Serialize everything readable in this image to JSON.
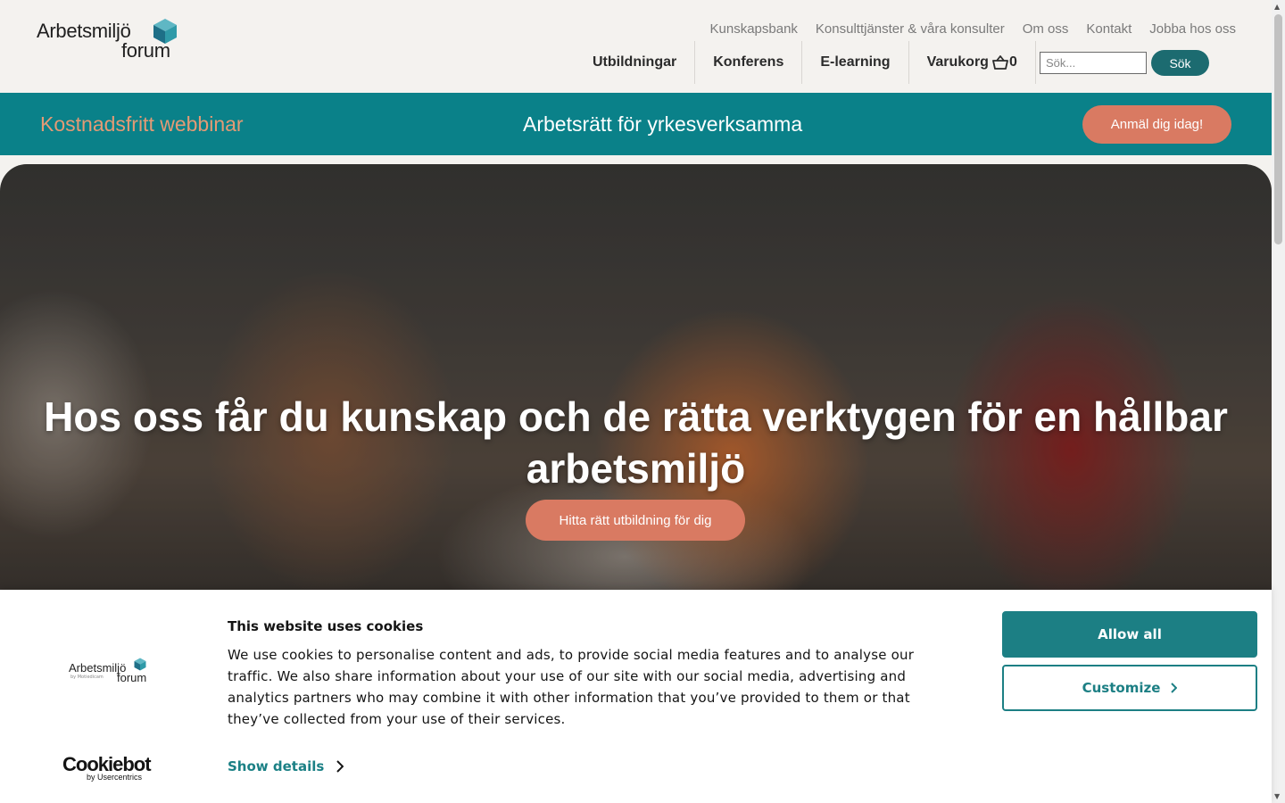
{
  "logo": {
    "line1": "Arbetsmiljö",
    "line2": "forum"
  },
  "top_nav": [
    "Kunskapsbank",
    "Konsulttjänster & våra konsulter",
    "Om oss",
    "Kontakt",
    "Jobba hos oss"
  ],
  "main_nav": {
    "items": [
      "Utbildningar",
      "Konferens",
      "E-learning"
    ],
    "cart_label": "Varukorg",
    "cart_count": "0"
  },
  "search": {
    "placeholder": "Sök...",
    "button": "Sök"
  },
  "banner": {
    "left": "Kostnadsfritt webbinar",
    "center": "Arbetsrätt för yrkesverksamma",
    "button": "Anmäl dig idag!"
  },
  "hero": {
    "title": "Hos oss får du kunskap och de rätta verktygen för en hållbar arbetsmiljö",
    "button": "Hitta rätt utbildning för dig"
  },
  "cookie": {
    "logo_line1": "Arbetsmiljö",
    "logo_line2": "forum",
    "logo_sub": "by Motiedicam",
    "cookiebot": "Cookiebot",
    "cookiebot_sub": "by Usercentrics",
    "title": "This website uses cookies",
    "text": "We use cookies to personalise content and ads, to provide social media features and to analyse our traffic. We also share information about your use of our site with our social media, advertising and analytics partners who may combine it with other information that you’ve provided to them or that they’ve collected from your use of their services.",
    "show_details": "Show details",
    "allow_all": "Allow all",
    "customize": "Customize"
  },
  "colors": {
    "teal": "#0a8189",
    "accent": "#d97a62",
    "dark_teal": "#1c6b70",
    "cookie_teal": "#1c7f84"
  }
}
